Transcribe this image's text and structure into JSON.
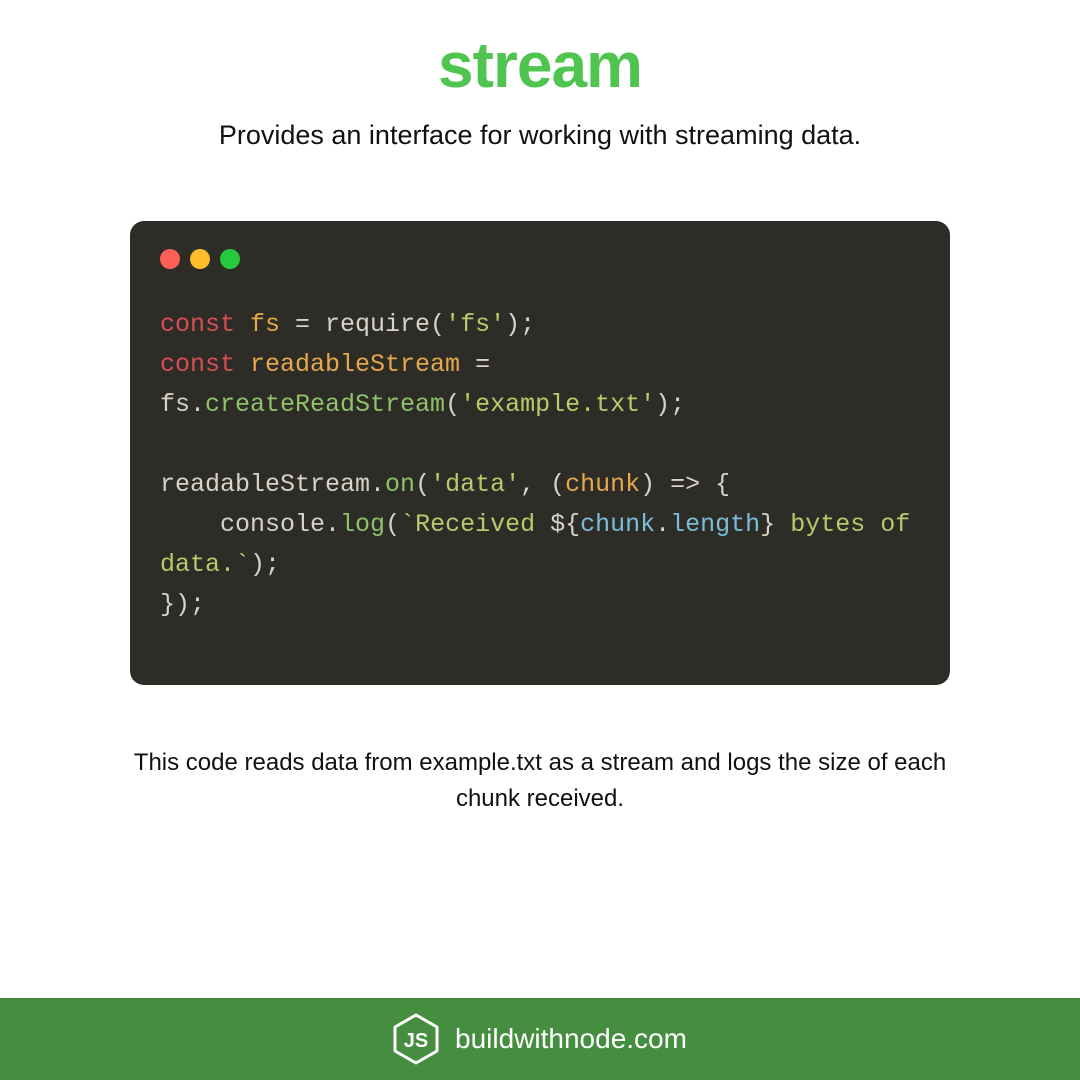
{
  "title": "stream",
  "subtitle": "Provides an interface for working with streaming data.",
  "code": {
    "tokens": [
      {
        "t": "const ",
        "c": "keyword"
      },
      {
        "t": "fs",
        "c": "var"
      },
      {
        "t": " = require(",
        "c": "default"
      },
      {
        "t": "'fs'",
        "c": "string"
      },
      {
        "t": ");\n",
        "c": "default"
      },
      {
        "t": "const ",
        "c": "keyword"
      },
      {
        "t": "readableStream",
        "c": "var"
      },
      {
        "t": " = \nfs.",
        "c": "default"
      },
      {
        "t": "createReadStream",
        "c": "method"
      },
      {
        "t": "(",
        "c": "default"
      },
      {
        "t": "'example.txt'",
        "c": "string"
      },
      {
        "t": ");\n\nreadableStream.",
        "c": "default"
      },
      {
        "t": "on",
        "c": "method"
      },
      {
        "t": "(",
        "c": "default"
      },
      {
        "t": "'data'",
        "c": "string"
      },
      {
        "t": ", (",
        "c": "default"
      },
      {
        "t": "chunk",
        "c": "var"
      },
      {
        "t": ") => {\n    console.",
        "c": "default"
      },
      {
        "t": "log",
        "c": "method"
      },
      {
        "t": "(",
        "c": "default"
      },
      {
        "t": "`Received ",
        "c": "string"
      },
      {
        "t": "${",
        "c": "default"
      },
      {
        "t": "chunk",
        "c": "prop"
      },
      {
        "t": ".",
        "c": "default"
      },
      {
        "t": "length",
        "c": "prop"
      },
      {
        "t": "}",
        "c": "default"
      },
      {
        "t": " bytes of data.`",
        "c": "string"
      },
      {
        "t": ");\n});",
        "c": "default"
      }
    ]
  },
  "description": "This code reads data from example.txt as a stream and logs the size of each chunk received.",
  "footer_site": "buildwithnode.com",
  "colors": {
    "accent_green": "#4fc44f",
    "footer_green": "#468e3f",
    "code_bg": "#2e2c27"
  }
}
